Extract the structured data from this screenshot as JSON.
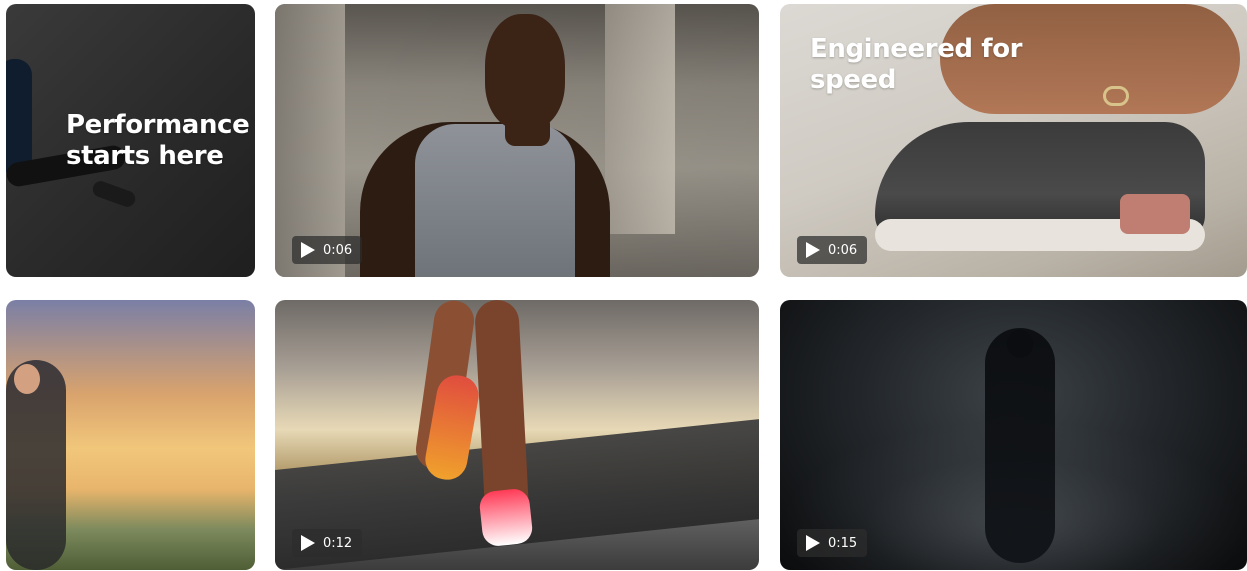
{
  "gallery": {
    "tiles": [
      {
        "id": "tile-1",
        "headline": "Performance\nstarts here",
        "duration": "",
        "icon": "running-person"
      },
      {
        "id": "tile-2",
        "headline": "",
        "duration": "0:06",
        "icon": "play-icon"
      },
      {
        "id": "tile-3",
        "headline": "Engineered for\nspeed",
        "duration": "0:06",
        "icon": "play-icon"
      },
      {
        "id": "tile-4",
        "headline": "",
        "duration": "",
        "icon": "running-person"
      },
      {
        "id": "tile-5",
        "headline": "",
        "duration": "0:12",
        "icon": "play-icon"
      },
      {
        "id": "tile-6",
        "headline": "",
        "duration": "0:15",
        "icon": "play-icon"
      }
    ]
  }
}
